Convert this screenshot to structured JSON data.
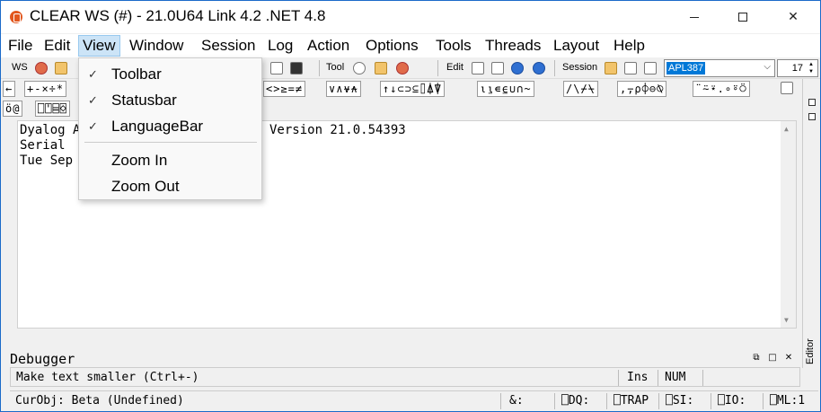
{
  "window": {
    "title": "CLEAR WS (#) - 21.0U64 Link 4.2 .NET 4.8",
    "accent": "#1b6ac9"
  },
  "menubar": {
    "items": [
      "File",
      "Edit",
      "View",
      "Window",
      "Session",
      "Log",
      "Action",
      "Options",
      "Tools",
      "Threads",
      "Layout",
      "Help"
    ],
    "active": "View"
  },
  "toolbar": {
    "ws_label": "WS",
    "tool_label": "Tool",
    "edit_label": "Edit",
    "session_label": "Session",
    "font_value": "APL387",
    "font_size": "17"
  },
  "language_bar": {
    "row1_groups": [
      "←",
      "+-×÷*",
      "<>≥=≠",
      "∨∧⍱⍲",
      "↑↓⊂⊃⊆⌷⍋⍒",
      "⍳⍸∊⍷∪∩~",
      "/\\⌿⍀",
      ",⍪⍴⌽⊖⍉",
      "¨⍨⍣.∘⍤⍥"
    ],
    "row2_groups": [
      "ö@",
      "⎕⍞⌸⌺"
    ]
  },
  "session": {
    "lines": [
      "Dyalog A",
      "Serial ",
      "Tue Sep"
    ],
    "version_text": "Version 21.0.54393"
  },
  "view_menu": {
    "items": [
      {
        "label": "Toolbar",
        "checked": true
      },
      {
        "label": "Statusbar",
        "checked": true
      },
      {
        "label": "LanguageBar",
        "checked": true
      },
      {
        "label": "Zoom In",
        "checked": false
      },
      {
        "label": "Zoom Out",
        "checked": false
      }
    ],
    "check_glyph": "✓"
  },
  "debugger": {
    "label": "Debugger"
  },
  "statusbar": {
    "hint": "Make text smaller (Ctrl+-)",
    "ins": "Ins",
    "num": "NUM",
    "curobj": "CurObj: Beta (Undefined)",
    "amp": "&:",
    "dq": "⎕DQ:",
    "trap": "⎕TRAP",
    "si": "⎕SI:",
    "io": "⎕IO:",
    "ml": "⎕ML:1"
  },
  "dock": {
    "editor_label": "Editor"
  }
}
